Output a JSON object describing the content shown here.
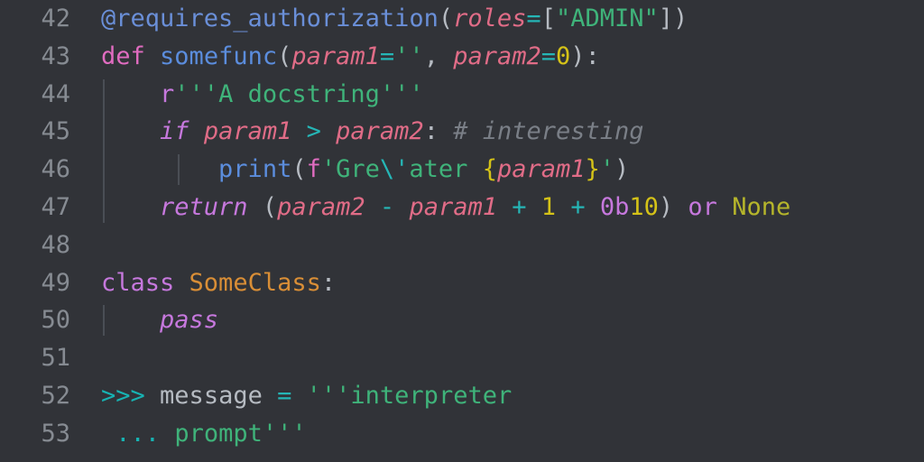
{
  "editor": {
    "background_color": "#313338",
    "gutter_color": "#868b92",
    "indent_guide_color": "#4a4e55",
    "font_size_px": 27,
    "line_height_px": 41.8,
    "language": "python",
    "first_line_number": 42,
    "last_line_number": 53
  },
  "palette": {
    "default": "#bfc4cc",
    "decorator": "#6a8fd8",
    "keyword": "#c678dd",
    "def_keyword": "#e06cc0",
    "function": "#5b8ddd",
    "param": "#e06c87",
    "operator": "#25b6b6",
    "string": "#3fb37a",
    "string_prefix": "#c678dd",
    "escape": "#25b6b6",
    "number": "#d4c218",
    "number_prefix": "#c678dd",
    "comment": "#7a7f87",
    "class_name": "#d98e36",
    "punctuation": "#b6bbc2",
    "builtin_const": "#b5b52b",
    "prompt": "#17b2b2",
    "fstring_brace": "#d4c218"
  },
  "lines": [
    {
      "number": "42",
      "indent_levels": 0,
      "text": "@requires_authorization(roles=[\"ADMIN\"])",
      "tokens": [
        {
          "text": "@requires_authorization",
          "type": "decorator"
        },
        {
          "text": "(",
          "type": "punct"
        },
        {
          "text": "roles",
          "type": "param"
        },
        {
          "text": "=",
          "type": "operator"
        },
        {
          "text": "[",
          "type": "punct"
        },
        {
          "text": "\"ADMIN\"",
          "type": "string"
        },
        {
          "text": "]",
          "type": "punct"
        },
        {
          "text": ")",
          "type": "punct"
        }
      ]
    },
    {
      "number": "43",
      "indent_levels": 0,
      "text": "def somefunc(param1='', param2=0):",
      "tokens": [
        {
          "text": "def",
          "type": "def"
        },
        {
          "text": " ",
          "type": "default"
        },
        {
          "text": "somefunc",
          "type": "func"
        },
        {
          "text": "(",
          "type": "punct"
        },
        {
          "text": "param1",
          "type": "param"
        },
        {
          "text": "=",
          "type": "operator"
        },
        {
          "text": "''",
          "type": "string"
        },
        {
          "text": ",",
          "type": "punct"
        },
        {
          "text": " ",
          "type": "default"
        },
        {
          "text": "param2",
          "type": "param"
        },
        {
          "text": "=",
          "type": "operator"
        },
        {
          "text": "0",
          "type": "number"
        },
        {
          "text": ")",
          "type": "punct"
        },
        {
          "text": ":",
          "type": "punct"
        }
      ]
    },
    {
      "number": "44",
      "indent_levels": 1,
      "text": "    r'''A docstring'''",
      "tokens": [
        {
          "text": "    ",
          "type": "default"
        },
        {
          "text": "r",
          "type": "strprefix"
        },
        {
          "text": "'''A docstring'''",
          "type": "string"
        }
      ]
    },
    {
      "number": "45",
      "indent_levels": 1,
      "text": "    if param1 > param2: # interesting",
      "tokens": [
        {
          "text": "    ",
          "type": "default"
        },
        {
          "text": "if",
          "type": "keyword-i"
        },
        {
          "text": " ",
          "type": "default"
        },
        {
          "text": "param1",
          "type": "param"
        },
        {
          "text": " ",
          "type": "default"
        },
        {
          "text": ">",
          "type": "operator"
        },
        {
          "text": " ",
          "type": "default"
        },
        {
          "text": "param2",
          "type": "param"
        },
        {
          "text": ":",
          "type": "punct"
        },
        {
          "text": " ",
          "type": "default"
        },
        {
          "text": "# interesting",
          "type": "comment"
        }
      ]
    },
    {
      "number": "46",
      "indent_levels": 2,
      "text": "        print(f'Gre\\'ater {param1}')",
      "tokens": [
        {
          "text": "        ",
          "type": "default"
        },
        {
          "text": "print",
          "type": "func"
        },
        {
          "text": "(",
          "type": "punct"
        },
        {
          "text": "f",
          "type": "def"
        },
        {
          "text": "'Gre",
          "type": "string"
        },
        {
          "text": "\\'",
          "type": "escape"
        },
        {
          "text": "ater ",
          "type": "string"
        },
        {
          "text": "{",
          "type": "fbrace"
        },
        {
          "text": "param1",
          "type": "param"
        },
        {
          "text": "}",
          "type": "fbrace"
        },
        {
          "text": "'",
          "type": "string"
        },
        {
          "text": ")",
          "type": "punct"
        }
      ]
    },
    {
      "number": "47",
      "indent_levels": 1,
      "text": "    return (param2 - param1 + 1 + 0b10) or None",
      "tokens": [
        {
          "text": "    ",
          "type": "default"
        },
        {
          "text": "return",
          "type": "keyword-i"
        },
        {
          "text": " ",
          "type": "default"
        },
        {
          "text": "(",
          "type": "punct"
        },
        {
          "text": "param2",
          "type": "param"
        },
        {
          "text": " ",
          "type": "default"
        },
        {
          "text": "-",
          "type": "operator"
        },
        {
          "text": " ",
          "type": "default"
        },
        {
          "text": "param1",
          "type": "param"
        },
        {
          "text": " ",
          "type": "default"
        },
        {
          "text": "+",
          "type": "operator"
        },
        {
          "text": " ",
          "type": "default"
        },
        {
          "text": "1",
          "type": "number"
        },
        {
          "text": " ",
          "type": "default"
        },
        {
          "text": "+",
          "type": "operator"
        },
        {
          "text": " ",
          "type": "default"
        },
        {
          "text": "0b",
          "type": "numprefix"
        },
        {
          "text": "10",
          "type": "number"
        },
        {
          "text": ")",
          "type": "punct"
        },
        {
          "text": " ",
          "type": "default"
        },
        {
          "text": "or",
          "type": "keyword"
        },
        {
          "text": " ",
          "type": "default"
        },
        {
          "text": "None",
          "type": "builtin"
        }
      ]
    },
    {
      "number": "48",
      "indent_levels": 0,
      "text": "",
      "tokens": []
    },
    {
      "number": "49",
      "indent_levels": 0,
      "text": "class SomeClass:",
      "tokens": [
        {
          "text": "class",
          "type": "keyword"
        },
        {
          "text": " ",
          "type": "default"
        },
        {
          "text": "SomeClass",
          "type": "class"
        },
        {
          "text": ":",
          "type": "punct"
        }
      ]
    },
    {
      "number": "50",
      "indent_levels": 1,
      "text": "    pass",
      "tokens": [
        {
          "text": "    ",
          "type": "default"
        },
        {
          "text": "pass",
          "type": "keyword-i"
        }
      ]
    },
    {
      "number": "51",
      "indent_levels": 0,
      "text": "",
      "tokens": []
    },
    {
      "number": "52",
      "indent_levels": 0,
      "text": ">>> message = '''interpreter",
      "tokens": [
        {
          "text": ">>>",
          "type": "prompt"
        },
        {
          "text": " ",
          "type": "default"
        },
        {
          "text": "message",
          "type": "name"
        },
        {
          "text": " ",
          "type": "default"
        },
        {
          "text": "=",
          "type": "operator"
        },
        {
          "text": " ",
          "type": "default"
        },
        {
          "text": "'''interpreter",
          "type": "string"
        }
      ]
    },
    {
      "number": "53",
      "indent_levels": 0,
      "text": " ... prompt'''",
      "tokens": [
        {
          "text": " ",
          "type": "default"
        },
        {
          "text": "...",
          "type": "prompt"
        },
        {
          "text": " ",
          "type": "default"
        },
        {
          "text": "prompt'''",
          "type": "string"
        }
      ]
    }
  ],
  "indent_guides": [
    {
      "level": 1,
      "start_line": "44",
      "end_line": "47"
    },
    {
      "level": 2,
      "start_line": "46",
      "end_line": "46"
    },
    {
      "level": 1,
      "start_line": "50",
      "end_line": "50"
    }
  ]
}
